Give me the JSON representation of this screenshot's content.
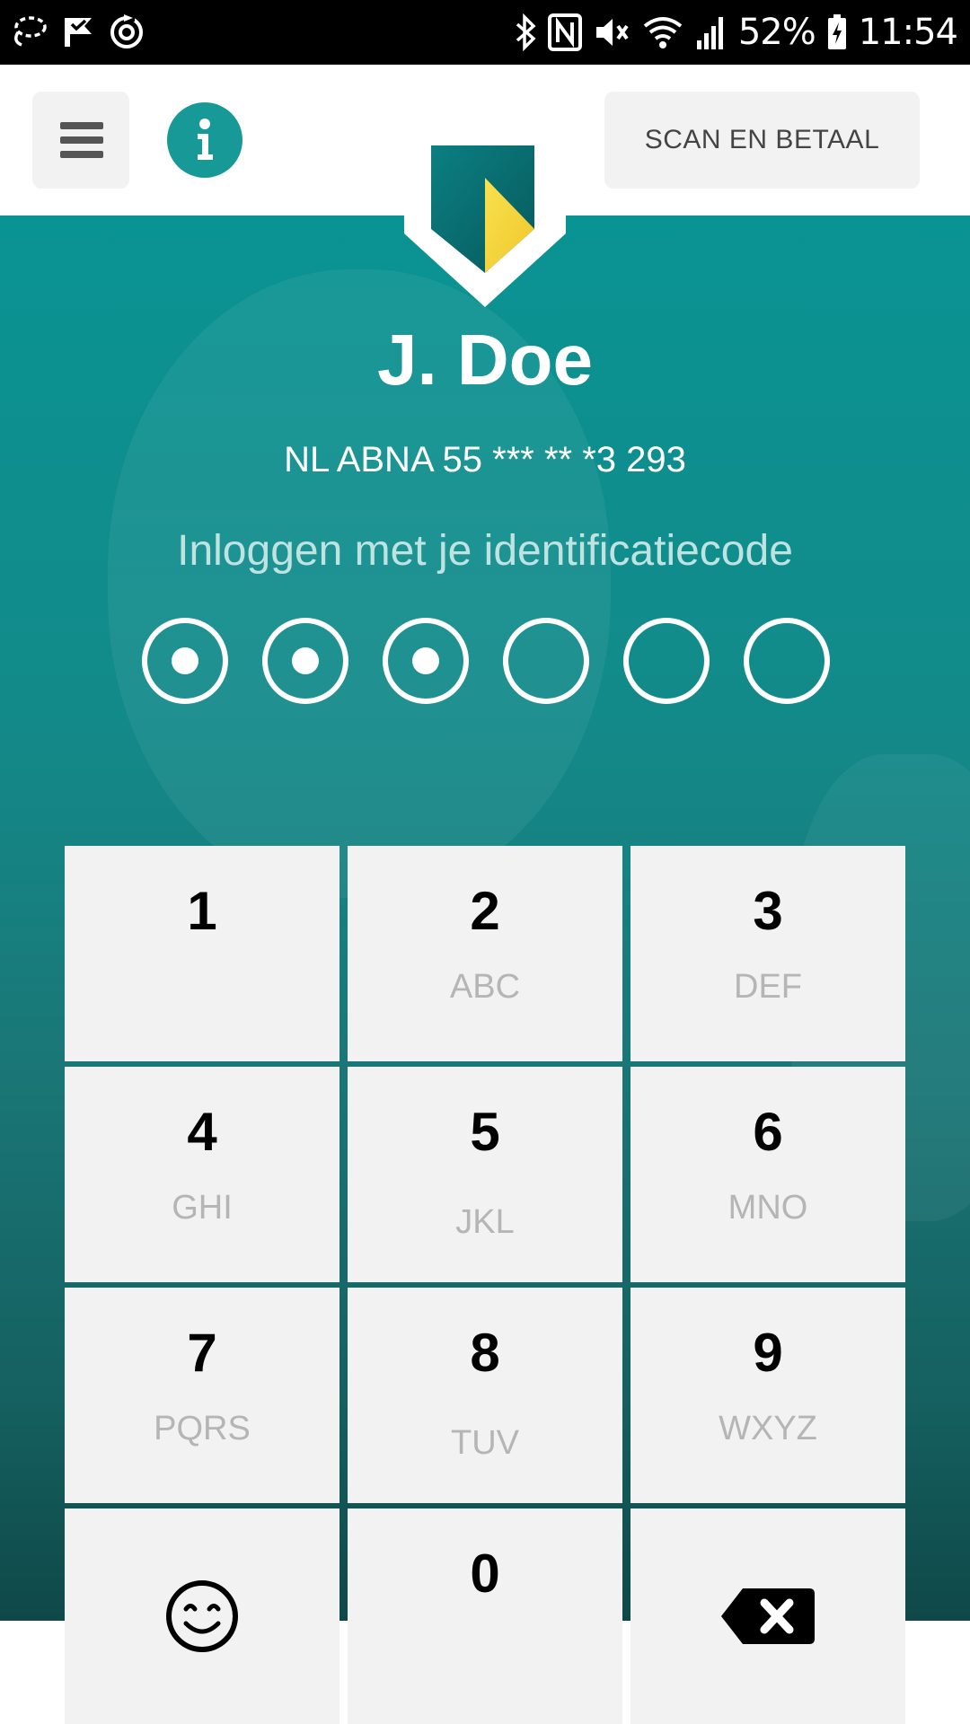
{
  "status_bar": {
    "battery_percent": "52%",
    "time": "11:54",
    "left_icons": [
      "lasso-icon",
      "check-flag-icon",
      "sync-icon"
    ],
    "right_icons": [
      "bluetooth-icon",
      "nfc-icon",
      "mute-icon",
      "wifi-icon",
      "signal-icon",
      "battery-charging-icon"
    ]
  },
  "header": {
    "menu_icon": "hamburger-menu-icon",
    "info_icon": "info-icon",
    "scan_label": "SCAN EN BETAAL",
    "brand_color": "#179997",
    "logo": "shield-logo"
  },
  "login": {
    "name": "J. Doe",
    "account": "NL ABNA 55 *** ** *3 293",
    "prompt": "Inloggen met je identificatiecode",
    "code_length": 6,
    "digits_entered": 3
  },
  "keypad": {
    "keys": [
      {
        "digit": "1",
        "letters": ""
      },
      {
        "digit": "2",
        "letters": "ABC"
      },
      {
        "digit": "3",
        "letters": "DEF"
      },
      {
        "digit": "4",
        "letters": "GHI"
      },
      {
        "digit": "5",
        "letters": "JKL"
      },
      {
        "digit": "6",
        "letters": "MNO"
      },
      {
        "digit": "7",
        "letters": "PQRS"
      },
      {
        "digit": "8",
        "letters": "TUV"
      },
      {
        "digit": "9",
        "letters": "WXYZ"
      }
    ],
    "bottom_left_icon": "smiley-icon",
    "zero": "0",
    "bottom_right_icon": "backspace-icon"
  },
  "colors": {
    "teal_top": "#0a9393",
    "teal_bottom": "#0f4848",
    "key_bg": "#f2f2f2",
    "letters": "#b5b5b5",
    "logo_yellow": "#f5d63d"
  }
}
